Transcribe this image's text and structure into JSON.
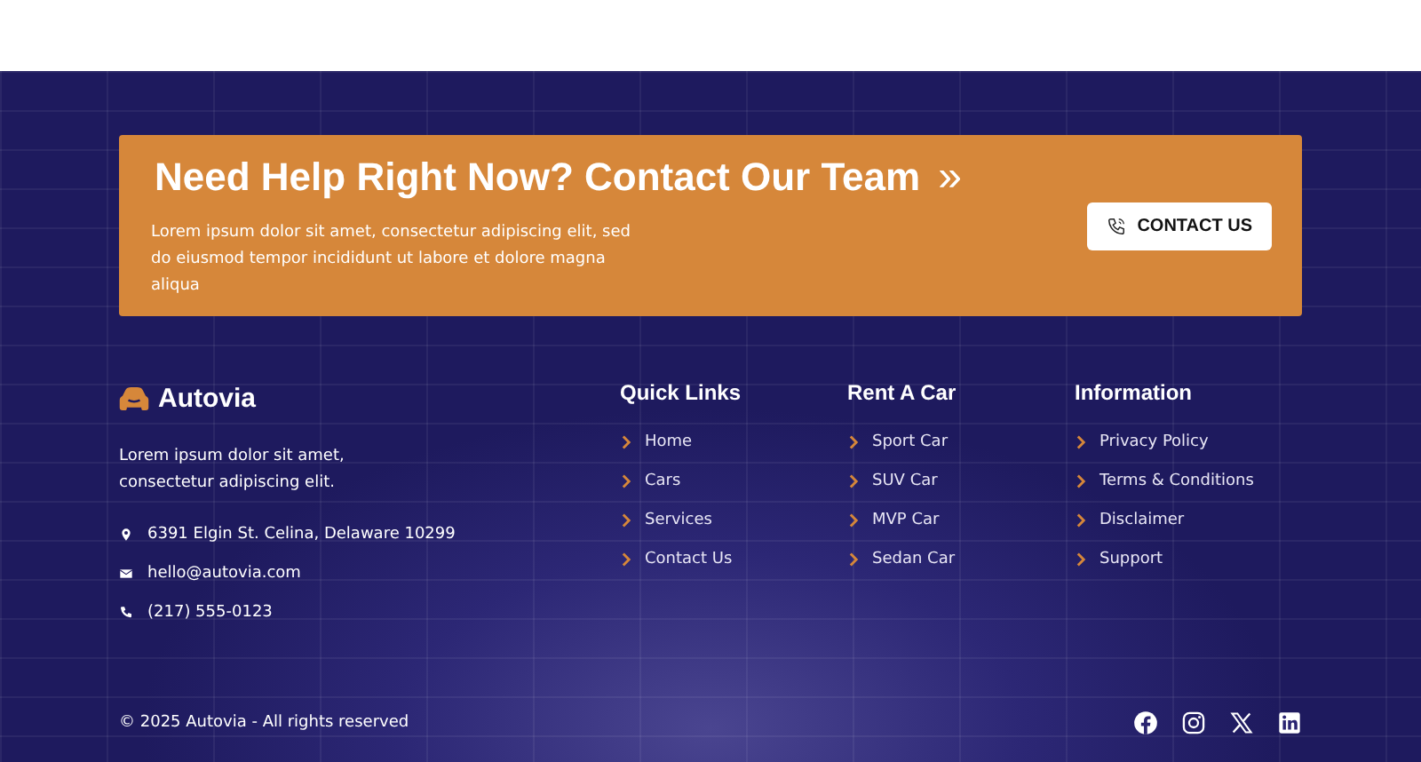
{
  "banner": {
    "title": "Need Help Right Now? Contact Our Team",
    "title_icon": "»",
    "text": "Lorem ipsum dolor sit amet, consectetur adipiscing elit, sed do eiusmod tempor incididunt ut labore et dolore magna aliqua",
    "button": "CONTACT US"
  },
  "brand": {
    "name": "Autovia",
    "description": "Lorem ipsum dolor sit amet, consectetur adipiscing elit."
  },
  "contacts": [
    {
      "kind": "address",
      "text": "6391 Elgin St. Celina, Delaware 10299"
    },
    {
      "kind": "email",
      "text": "hello@autovia.com"
    },
    {
      "kind": "phone",
      "text": "(217) 555-0123"
    }
  ],
  "columns": [
    {
      "title": "Quick Links",
      "links": [
        "Home",
        "Cars",
        "Services",
        "Contact Us"
      ]
    },
    {
      "title": "Rent A Car",
      "links": [
        "Sport Car",
        "SUV Car",
        "MVP Car",
        "Sedan Car"
      ]
    },
    {
      "title": "Information",
      "links": [
        "Privacy Policy",
        "Terms & Conditions",
        "Disclaimer",
        "Support"
      ]
    }
  ],
  "copyright": "© 2025 Autovia - All rights reserved",
  "socials": [
    {
      "kind": "facebook"
    },
    {
      "kind": "instagram"
    },
    {
      "kind": "x"
    },
    {
      "kind": "linkedin"
    }
  ]
}
